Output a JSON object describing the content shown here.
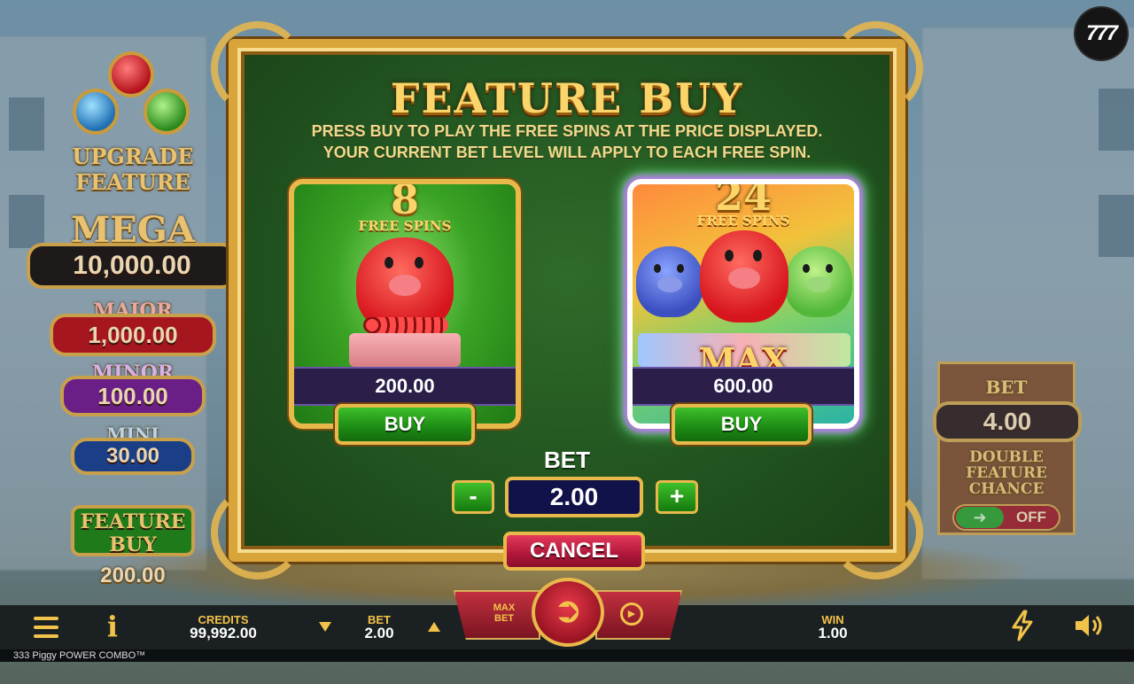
{
  "side_left": {
    "upgrade_line1": "UPGRADE",
    "upgrade_line2": "FEATURE",
    "mega_label": "MEGA",
    "mega_value": "10,000.00",
    "major_label": "MAJOR",
    "major_value": "1,000.00",
    "minor_label": "MINOR",
    "minor_value": "100.00",
    "mini_label": "MINI",
    "mini_value": "30.00",
    "feature_buy_line1": "FEATURE",
    "feature_buy_line2": "BUY",
    "feature_buy_price": "200.00"
  },
  "side_right": {
    "bet_label": "BET",
    "bet_value": "4.00",
    "dfc_line1": "DOUBLE",
    "dfc_line2": "FEATURE",
    "dfc_line3": "CHANCE",
    "toggle_state": "OFF"
  },
  "logo_text": "777",
  "modal": {
    "title": "FEATURE BUY",
    "desc_line1": "PRESS BUY TO PLAY THE FREE SPINS AT THE PRICE DISPLAYED.",
    "desc_line2": "YOUR CURRENT BET LEVEL WILL APPLY TO EACH FREE SPIN.",
    "options": [
      {
        "spins": "8",
        "spins_label": "FREE SPINS",
        "price": "200.00",
        "buy_label": "BUY"
      },
      {
        "spins": "24",
        "spins_label": "FREE SPINS",
        "badge": "MAX",
        "price": "600.00",
        "buy_label": "BUY"
      }
    ],
    "bet_label": "BET",
    "bet_value": "2.00",
    "minus_label": "-",
    "plus_label": "+",
    "cancel_label": "CANCEL"
  },
  "bottom": {
    "credits_label": "CREDITS",
    "credits_value": "99,992.00",
    "bet_label": "BET",
    "bet_value": "2.00",
    "max_bet_line1": "MAX",
    "max_bet_line2": "BET",
    "win_label": "WIN",
    "win_value": "1.00",
    "game_name": "333 Piggy POWER COMBO™"
  },
  "colors": {
    "accent_gold": "#f2c34a",
    "modal_green": "#225420",
    "buy_green": "#1c8a14",
    "cancel_red": "#b0173a"
  },
  "icons": [
    "menu-icon",
    "info-icon",
    "bet-down-arrow-icon",
    "bet-up-arrow-icon",
    "spin-arrow-icon",
    "autoplay-icon",
    "turbo-lightning-icon",
    "sound-speaker-icon"
  ]
}
